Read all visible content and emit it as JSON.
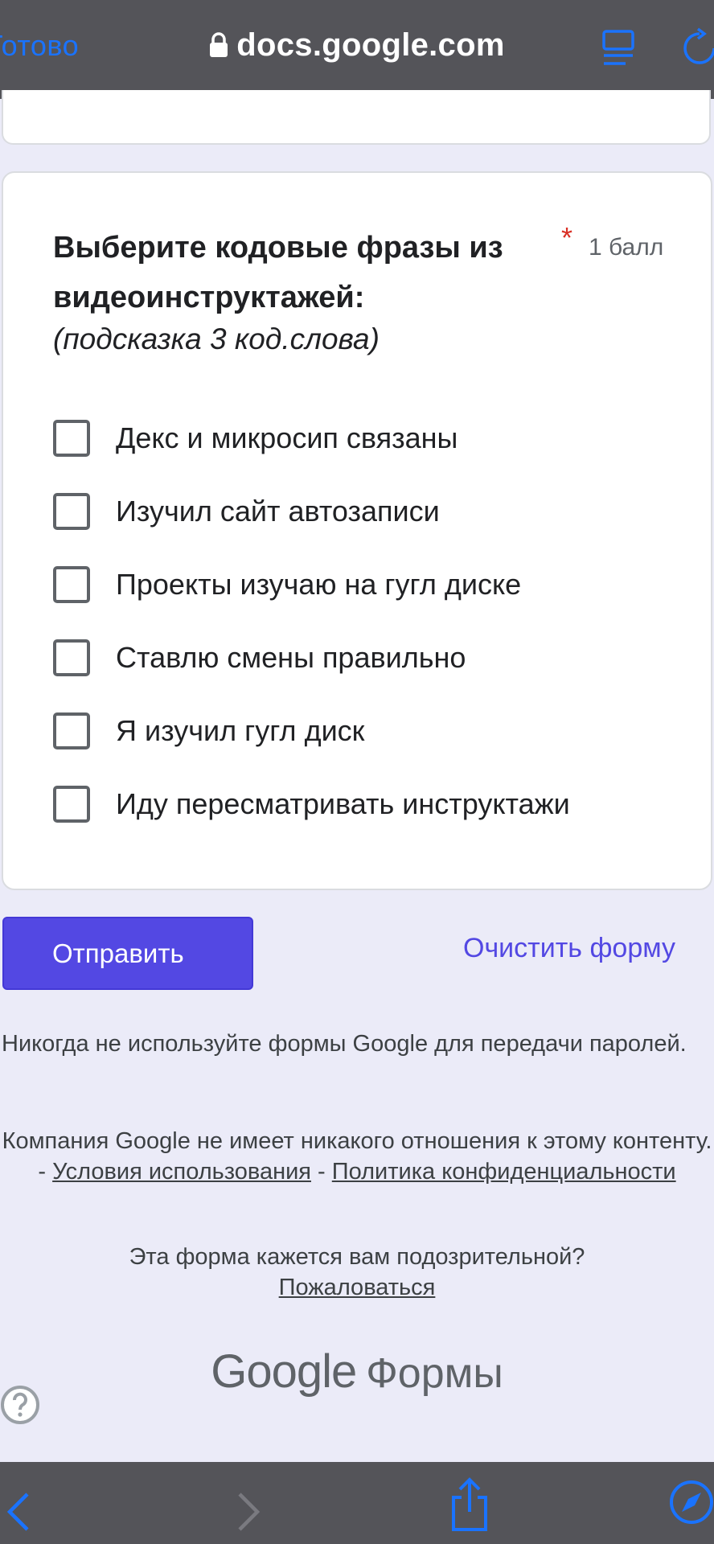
{
  "browser": {
    "done_label": "Готово",
    "url": "docs.google.com",
    "icons": [
      "lock-icon",
      "reader-icon",
      "reload-icon",
      "back-icon",
      "forward-icon",
      "share-icon",
      "compass-icon"
    ],
    "accent_color": "#1a73ff",
    "bar_color": "#545459"
  },
  "question": {
    "title": "Выберите кодовые фразы из видеоинструктажей:",
    "hint": "(подсказка 3 код.слова)",
    "required_mark": "*",
    "points": "1 балл",
    "options": [
      "Декс и микросип связаны",
      "Изучил сайт автозаписи",
      "Проекты изучаю на гугл диске",
      "Ставлю смены правильно",
      "Я изучил гугл диск",
      "Иду пересматривать инструктажи"
    ]
  },
  "actions": {
    "submit_label": "Отправить",
    "clear_label": "Очистить форму",
    "primary_color": "#5348e3"
  },
  "footer": {
    "warning": "Никогда не используйте формы Google для передачи паролей.",
    "disclaimer_text": "Компания Google не имеет никакого отношения к этому контенту.",
    "dash": "-",
    "terms_link": "Условия использования",
    "privacy_link": "Политика конфиденциальности",
    "suspicious_text": "Эта форма кажется вам подозрительной?",
    "report_link": "Пожаловаться",
    "brand_google": "Google",
    "brand_product": "Формы",
    "help_icon": "help-icon"
  }
}
